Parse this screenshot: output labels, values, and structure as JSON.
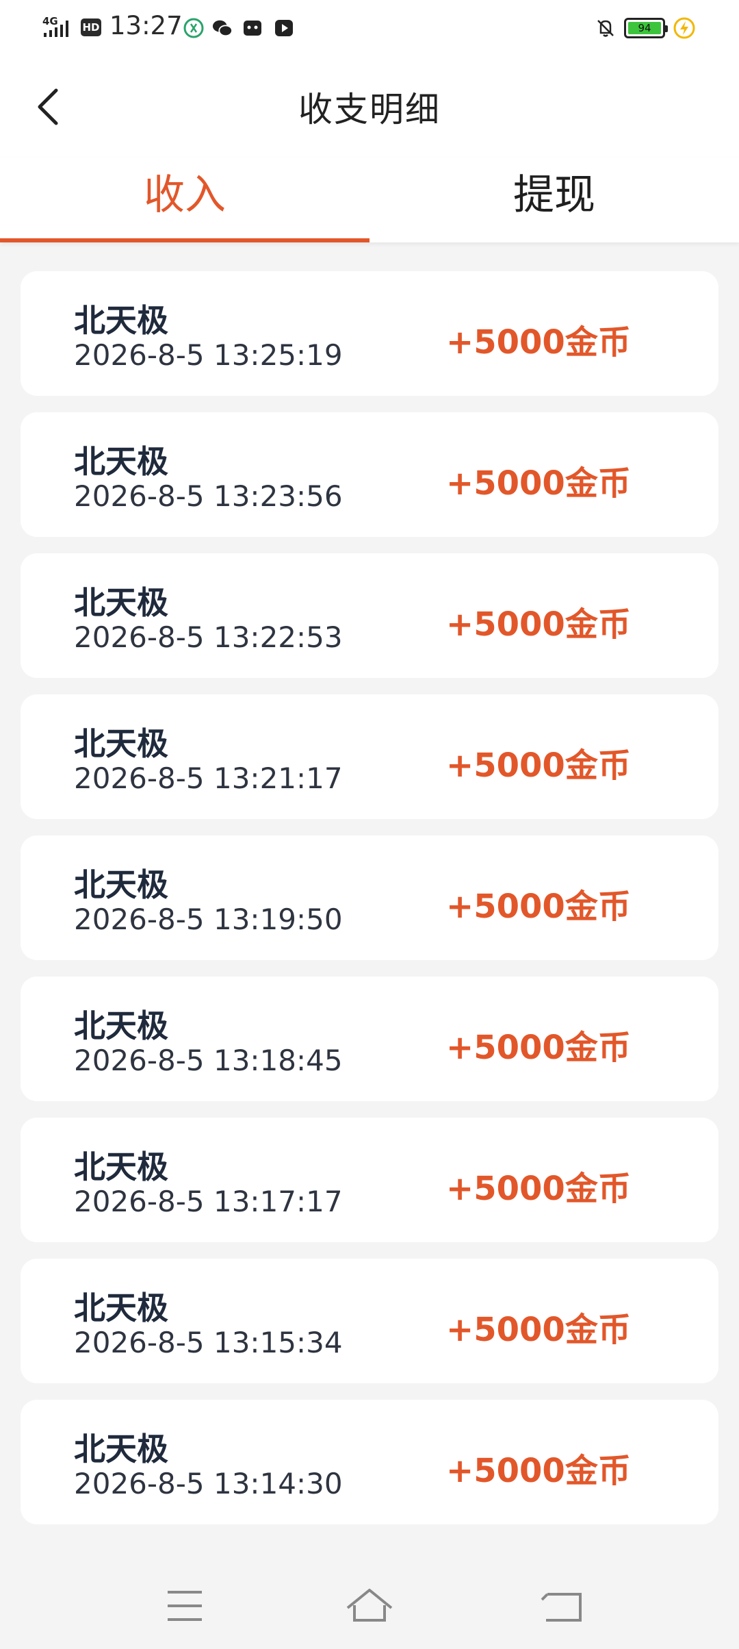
{
  "status_bar": {
    "network": "4G",
    "hd": "HD",
    "time": "13:27",
    "battery_level": "94",
    "battery_color": "#3cc43c"
  },
  "header": {
    "title": "收支明细"
  },
  "tabs": [
    {
      "label": "收入",
      "active": true
    },
    {
      "label": "提现",
      "active": false
    }
  ],
  "accent_color": "#e2572a",
  "records": [
    {
      "name": "北天极",
      "time": "2026-8-5 13:25:19",
      "amount": "+5000金币"
    },
    {
      "name": "北天极",
      "time": "2026-8-5 13:23:56",
      "amount": "+5000金币"
    },
    {
      "name": "北天极",
      "time": "2026-8-5 13:22:53",
      "amount": "+5000金币"
    },
    {
      "name": "北天极",
      "time": "2026-8-5 13:21:17",
      "amount": "+5000金币"
    },
    {
      "name": "北天极",
      "time": "2026-8-5 13:19:50",
      "amount": "+5000金币"
    },
    {
      "name": "北天极",
      "time": "2026-8-5 13:18:45",
      "amount": "+5000金币"
    },
    {
      "name": "北天极",
      "time": "2026-8-5 13:17:17",
      "amount": "+5000金币"
    },
    {
      "name": "北天极",
      "time": "2026-8-5 13:15:34",
      "amount": "+5000金币"
    },
    {
      "name": "北天极",
      "time": "2026-8-5 13:14:30",
      "amount": "+5000金币"
    }
  ],
  "nav_bar": {
    "icons": [
      "menu-icon",
      "home-icon",
      "back-icon"
    ]
  }
}
